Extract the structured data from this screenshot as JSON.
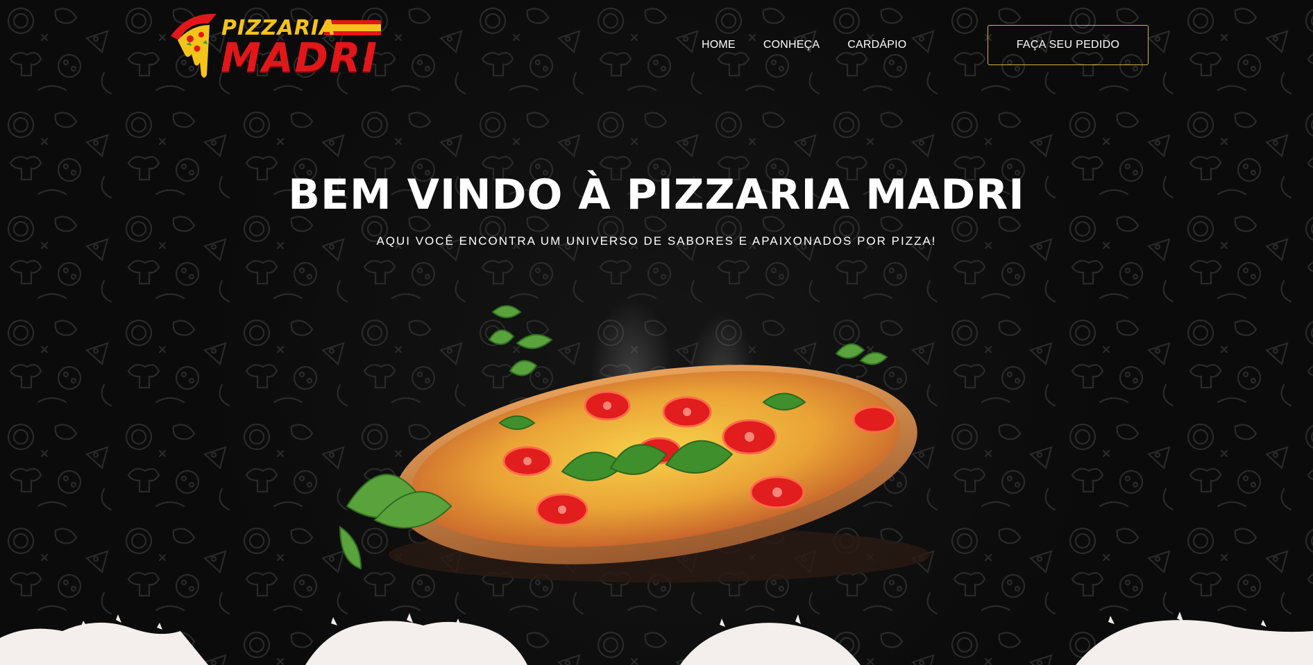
{
  "header": {
    "logo": {
      "word_top": "PIZZARIA",
      "word_bottom": "MADRI",
      "colors": {
        "yellow": "#f6c31a",
        "red": "#e3161a"
      }
    },
    "nav": [
      {
        "label": "HOME"
      },
      {
        "label": "CONHEÇA"
      },
      {
        "label": "CARDÁPIO"
      }
    ],
    "cta_label": "FAÇA SEU PEDIDO",
    "cta_border_color": "#d8b24a"
  },
  "hero": {
    "title": "BEM VINDO À PIZZARIA MADRI",
    "subtitle": "AQUI VOCÊ ENCONTRA UM UNIVERSO DE SABORES E APAIXONADOS POR PIZZA!"
  },
  "theme": {
    "background": "#0b0b0b",
    "text": "#ffffff",
    "splash": "#f4efec"
  },
  "icons": {
    "logo_slice": "pizza-slice-icon",
    "hero_image": "pizza-photo"
  }
}
